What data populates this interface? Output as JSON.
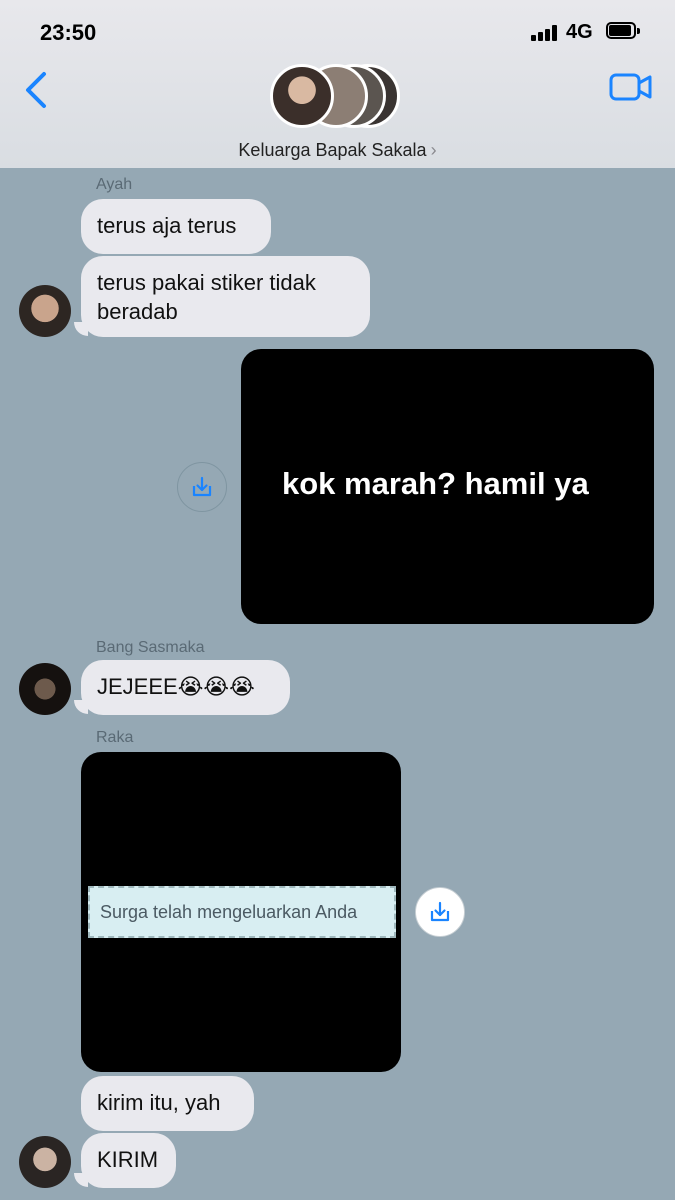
{
  "status_bar": {
    "time": "23:50",
    "network": "4G"
  },
  "header": {
    "group_name": "Keluarga Bapak Sakala",
    "chevron": "›"
  },
  "messages": {
    "m1_sender": "Ayah",
    "m1_text": "terus aja terus",
    "m2_text_line1": "terus pakai stiker tidak",
    "m2_text_line2": "beradab",
    "m3_image_caption": "kok marah? hamil ya",
    "m4_sender": "Bang Sasmaka",
    "m4_text": "JEJEEE😭😭😭",
    "m5_sender": "Raka",
    "m5_image_caption": "Surga telah mengeluarkan Anda",
    "m6_text": "kirim itu, yah",
    "m7_text": "KIRIM"
  },
  "colors": {
    "background": "#95a8b4",
    "bubble_incoming": "#e9e9ee",
    "accent": "#1a84ff"
  },
  "icons": [
    "back-chevron-icon",
    "video-camera-icon",
    "download-icon",
    "cellular-signal-icon",
    "battery-icon"
  ]
}
